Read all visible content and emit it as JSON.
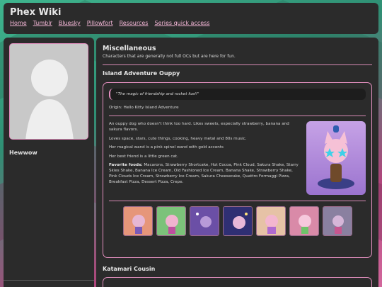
{
  "header": {
    "site_title": "Phex Wiki",
    "nav": [
      "Home",
      "Tumblr",
      "Bluesky",
      "Pillowfort",
      "Resources",
      "Series quick access"
    ]
  },
  "sidebar": {
    "name": "Hewwow"
  },
  "main": {
    "section_title": "Miscellaneous",
    "section_subtitle": "Characters that are generally not full OCs but are here for fun.",
    "character": {
      "title": "Island Adventure Ouppy",
      "quote": "\"The magic of friendship and rocket fuel!\"",
      "origin": "Origin: Hello Kitty Island Adventure",
      "paragraphs": [
        "An ouppy dog who doesn't think too hard. Likes sweets, especially strawberry, banana and sakura flavors.",
        "Loves space, stars, cute things, cooking, heavy metal and 80s music.",
        "Her magical wand is a pink spinel wand with gold accents",
        "Her best friend is a little green cat."
      ],
      "favorite_foods_label": "Favorite foods:",
      "favorite_foods": "Macarons, Strawberry Shortcake, Hot Cocoa, Pink Cloud, Sakura Shake, Starry Skies Shake, Banana Ice Cream, Old Fashioned Ice Cream, Banana Shake, Strawberry Shake, Pink Clouds Ice Cream, Strawberry Ice Cream, Sakura Cheesecake, Quattro Formaggi Pizza, Breakfast Pizza, Dessert Pizza, Crepe."
    },
    "next_character_title": "Katamari Cousin"
  },
  "colors": {
    "accent_pink": "#e38fbf",
    "panel_bg": "#2b2b2b",
    "link_pink": "#f3b6d6"
  }
}
